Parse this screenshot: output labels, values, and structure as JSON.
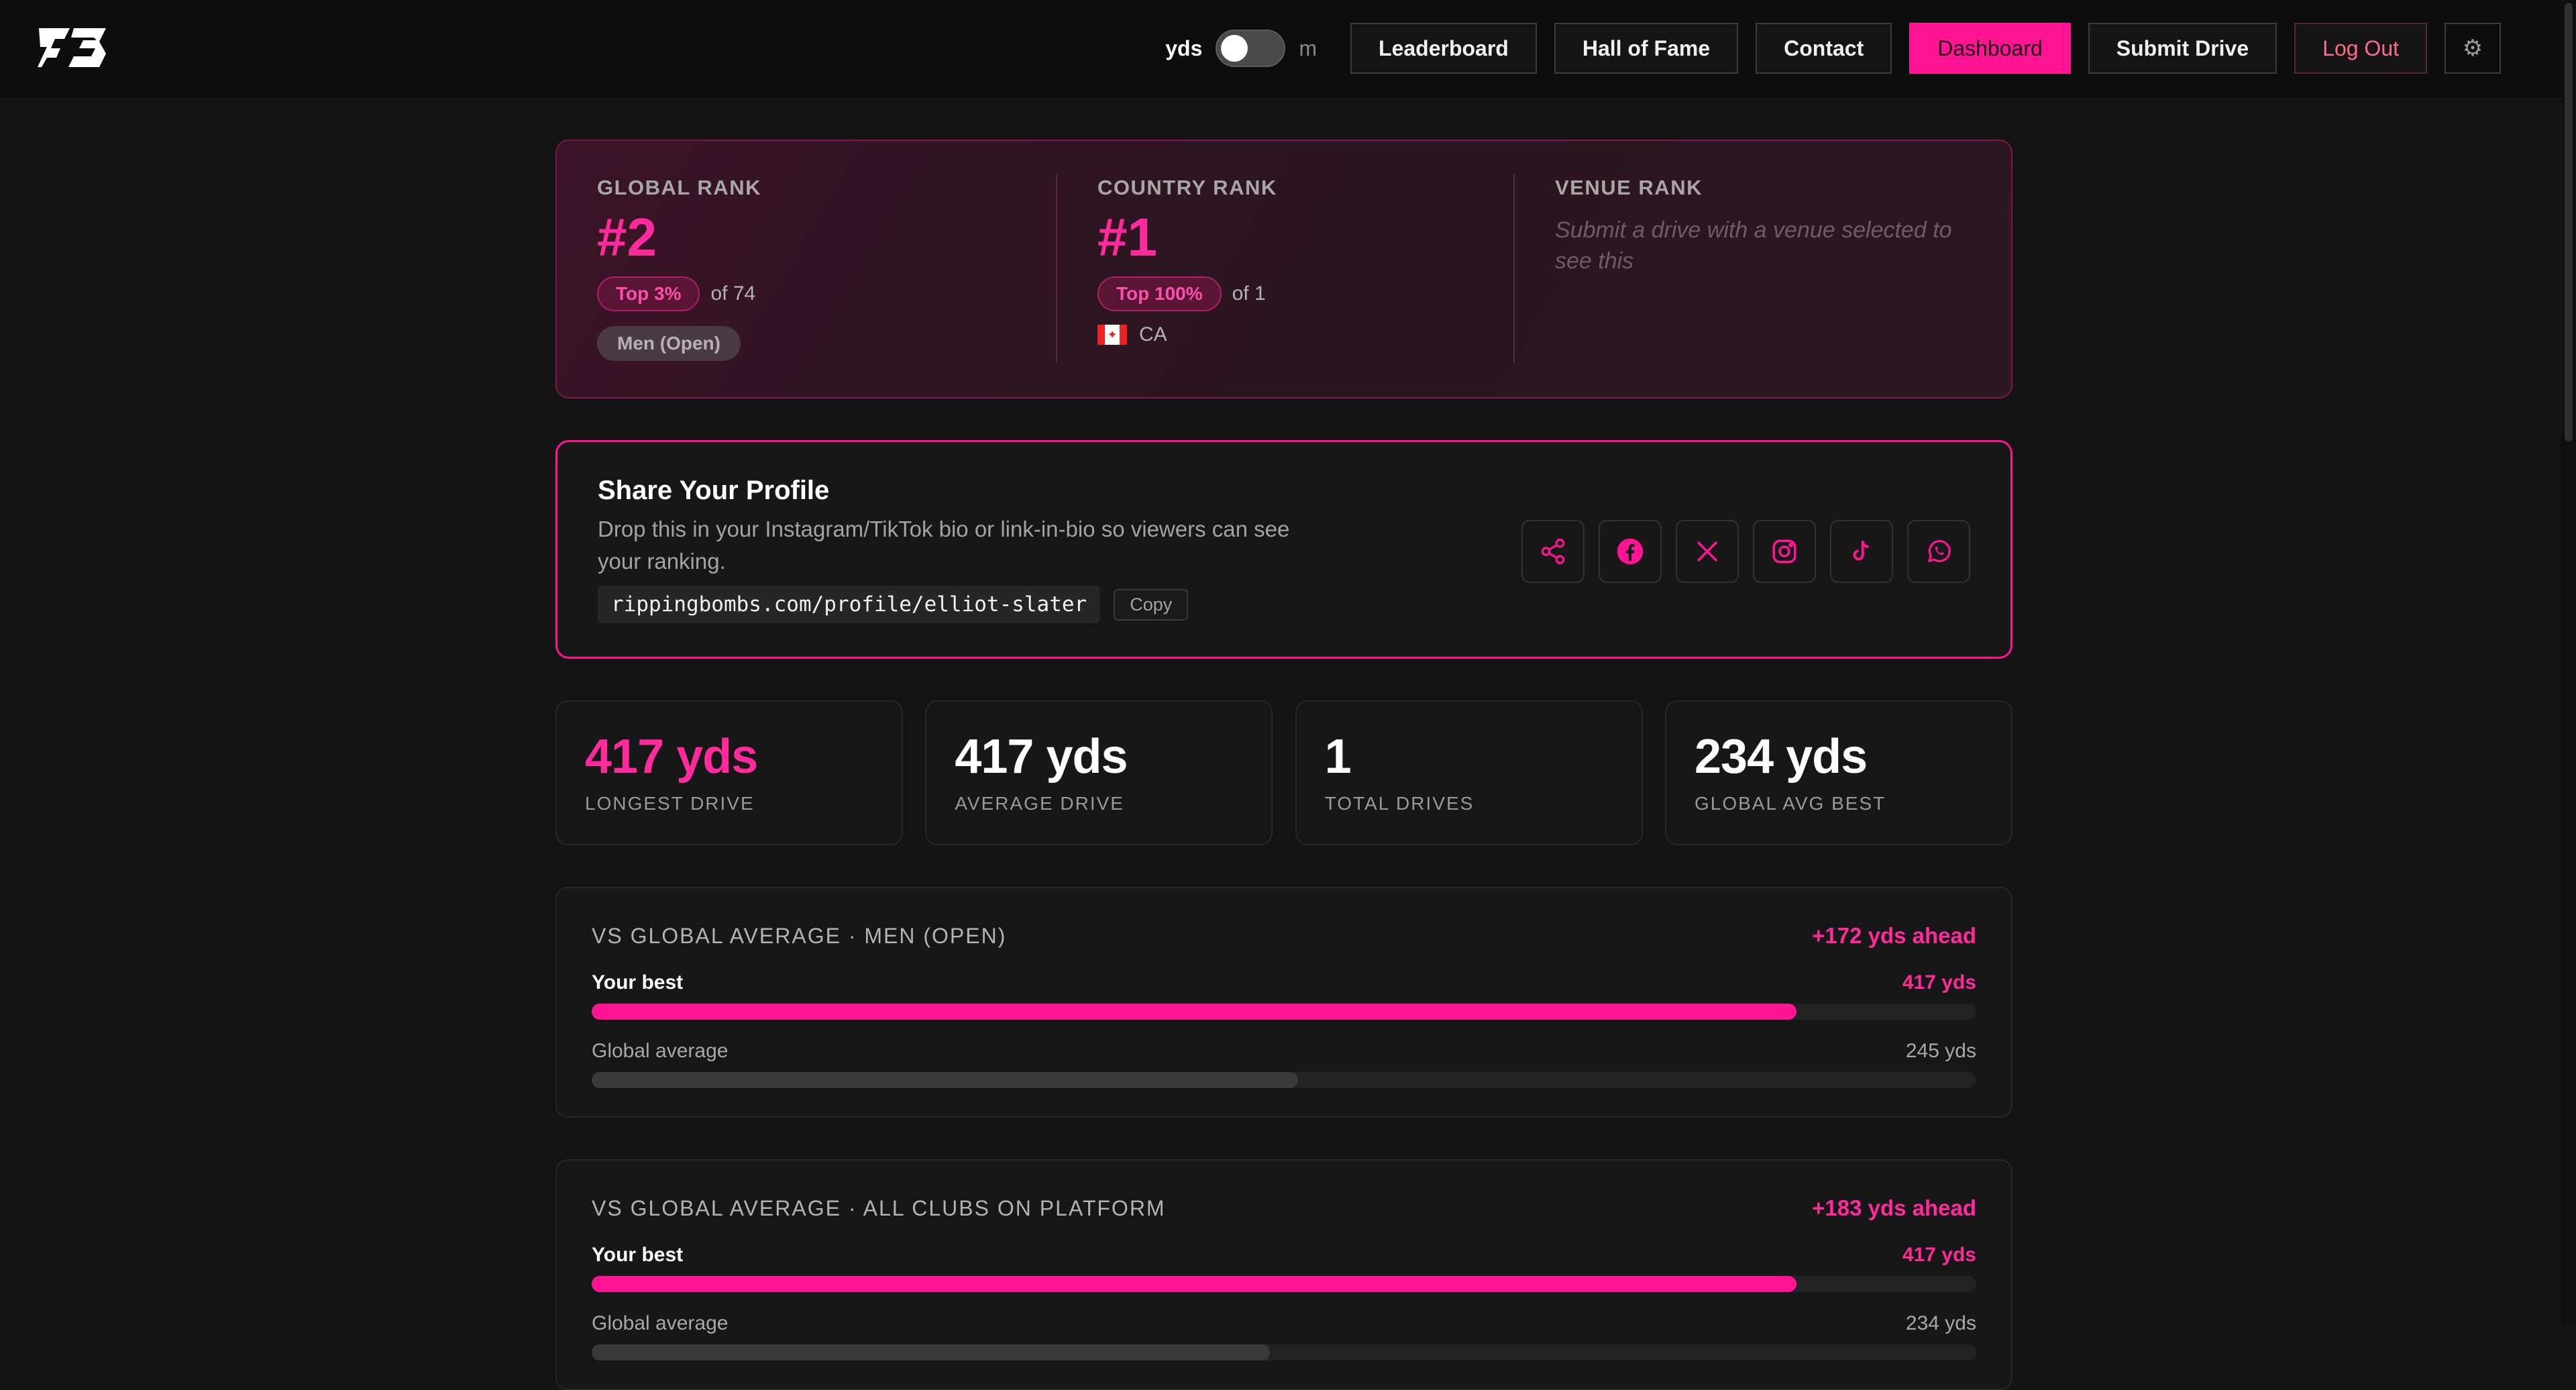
{
  "header": {
    "unit_left": "yds",
    "unit_right": "m",
    "nav": [
      "Leaderboard",
      "Hall of Fame",
      "Contact",
      "Dashboard",
      "Submit Drive",
      "Log Out"
    ],
    "active": "Dashboard",
    "settings_icon": "gear-icon"
  },
  "ranks": {
    "global": {
      "label": "GLOBAL RANK",
      "value": "#2",
      "top": "Top 3%",
      "of": "of 74",
      "category": "Men (Open)"
    },
    "country": {
      "label": "COUNTRY RANK",
      "value": "#1",
      "top": "Top 100%",
      "of": "of 1",
      "country": "CA",
      "flag_icon": "canada-flag-icon"
    },
    "venue": {
      "label": "VENUE RANK",
      "hint": "Submit a drive with a venue selected to see this"
    }
  },
  "share": {
    "title": "Share Your Profile",
    "description": "Drop this in your Instagram/TikTok bio or link-in-bio so viewers can see your ranking.",
    "url": "rippingbombs.com/profile/elliot-slater",
    "copy": "Copy",
    "icons": [
      "share-icon",
      "facebook-icon",
      "x-icon",
      "instagram-icon",
      "tiktok-icon",
      "whatsapp-icon"
    ]
  },
  "stats": [
    {
      "value": "417 yds",
      "label": "LONGEST DRIVE"
    },
    {
      "value": "417 yds",
      "label": "AVERAGE DRIVE"
    },
    {
      "value": "1",
      "label": "TOTAL DRIVES"
    },
    {
      "value": "234 yds",
      "label": "GLOBAL AVG BEST"
    }
  ],
  "comparisons": [
    {
      "title": "VS GLOBAL AVERAGE · MEN (OPEN)",
      "ahead": "+172 yds ahead",
      "best_label": "Your best",
      "best_value": "417 yds",
      "best_fraction": 0.87,
      "avg_label": "Global average",
      "avg_value": "245 yds",
      "avg_fraction": 0.51
    },
    {
      "title": "VS GLOBAL AVERAGE · ALL CLUBS ON PLATFORM",
      "ahead": "+183 yds ahead",
      "best_label": "Your best",
      "best_value": "417 yds",
      "best_fraction": 0.87,
      "avg_label": "Global average",
      "avg_value": "234 yds",
      "avg_fraction": 0.49
    }
  ],
  "colors": {
    "accent": "#ff1493",
    "background": "#141414",
    "card": "#171717"
  }
}
